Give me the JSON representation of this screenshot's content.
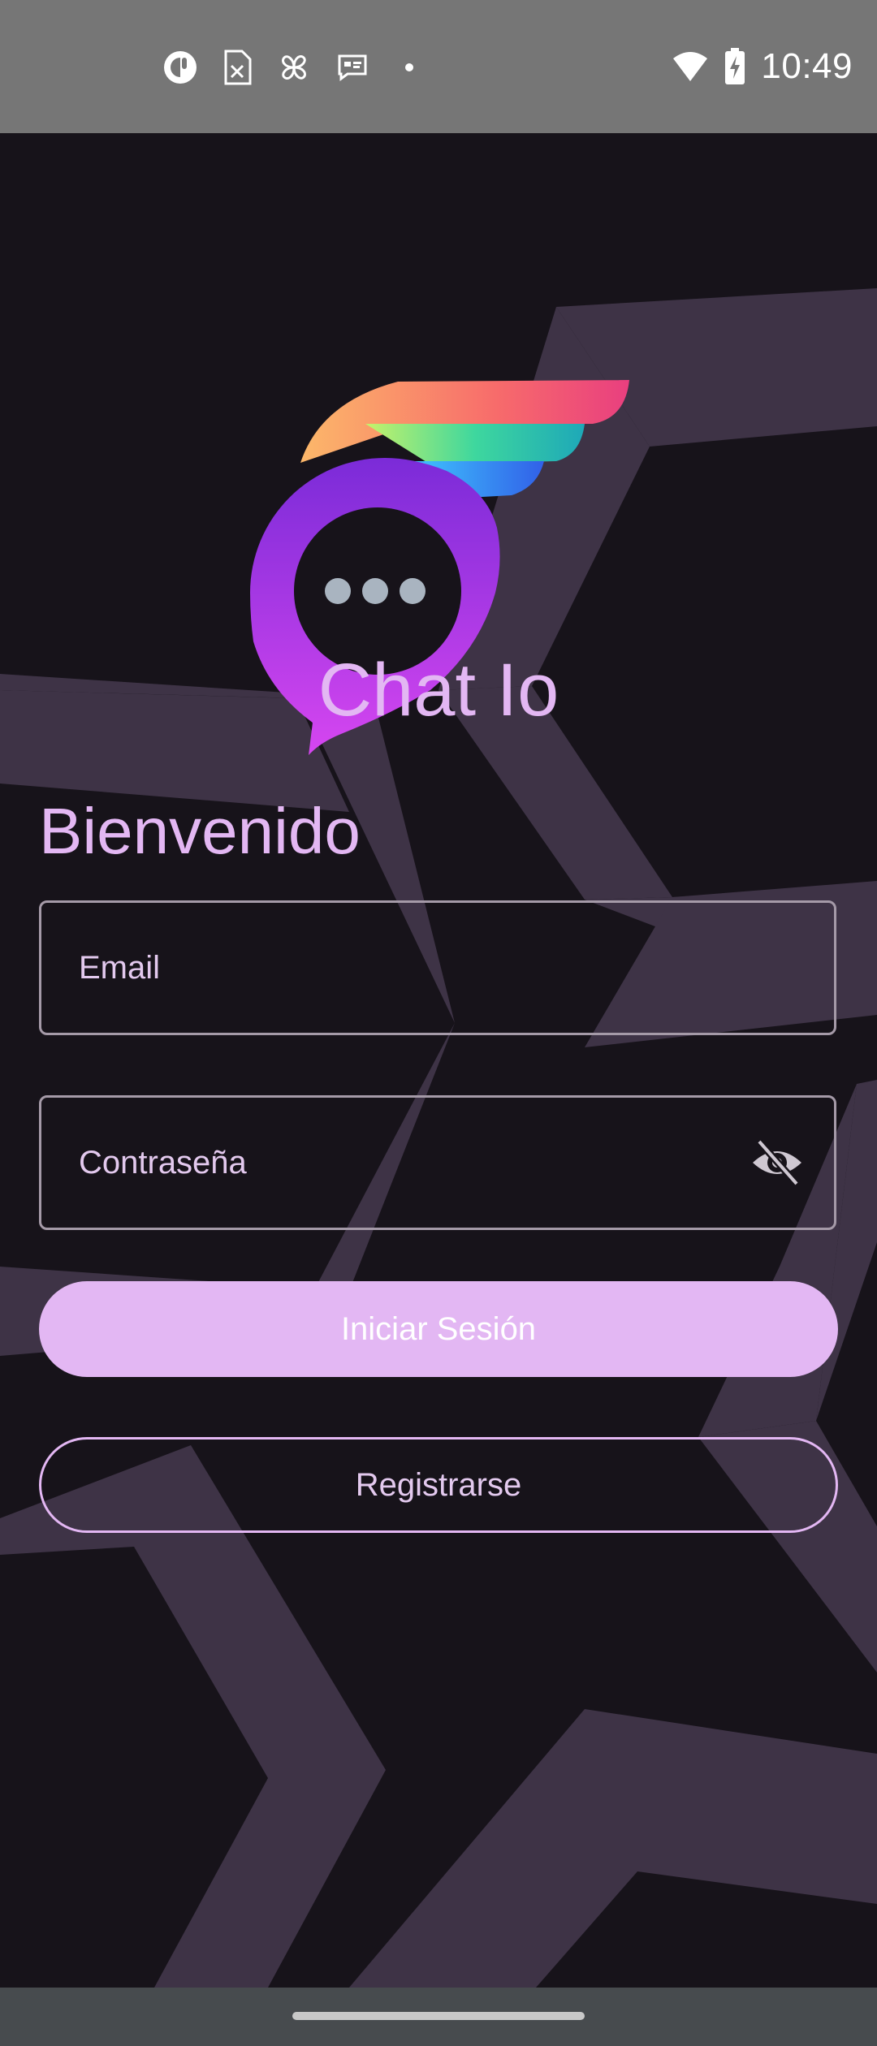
{
  "status_bar": {
    "time": "10:49",
    "left_icons": [
      "app-circle-icon",
      "sim-card-x-icon",
      "pinwheel-icon",
      "message-badge-icon",
      "dot-icon"
    ],
    "right_icons": [
      "wifi-icon",
      "battery-charging-icon"
    ]
  },
  "app": {
    "title": "Chat Io",
    "welcome": "Bienvenido"
  },
  "form": {
    "email_placeholder": "Email",
    "password_placeholder": "Contraseña",
    "password_toggle_icon": "eye-off-icon",
    "login_label": "Iniciar Sesión",
    "register_label": "Registrarse"
  },
  "colors": {
    "accent": "#e3b7f3",
    "background": "#17131a",
    "pattern": "#3e3346"
  }
}
